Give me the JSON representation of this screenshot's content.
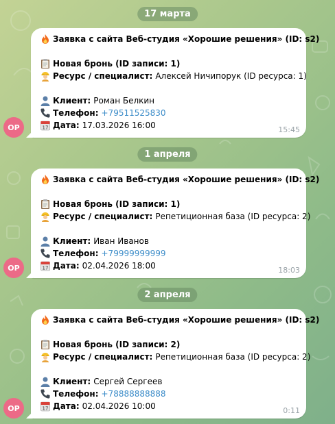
{
  "chat": {
    "messages": [
      {
        "date": "17 марта",
        "title": "Заявка с сайта Веб-студия «Хорошие решения» (ID: s2)",
        "booking_label": "Новая бронь (ID записи: 1)",
        "resource_label": "Ресурс / специалист:",
        "resource_value": "Алексей Ничипорук (ID ресурса: 1)",
        "client_label": "Клиент:",
        "client_value": "Роман Белкин",
        "phone_label": "Телефон:",
        "phone_value": "+79511525830",
        "date_label": "Дата:",
        "date_value": "17.03.2026 16:00",
        "time": "15:45",
        "avatar": "OP"
      },
      {
        "date": "1 апреля",
        "title": "Заявка с сайта Веб-студия «Хорошие решения» (ID: s2)",
        "booking_label": "Новая бронь (ID записи: 1)",
        "resource_label": "Ресурс / специалист:",
        "resource_value": "Репетиционная база (ID ресурса: 2)",
        "client_label": "Клиент:",
        "client_value": "Иван Иванов",
        "phone_label": "Телефон:",
        "phone_value": "+79999999999",
        "date_label": "Дата:",
        "date_value": "02.04.2026 18:00",
        "time": "18:03",
        "avatar": "OP"
      },
      {
        "date": "2 апреля",
        "title": "Заявка с сайта Веб-студия «Хорошие решения» (ID: s2)",
        "booking_label": "Новая бронь (ID записи: 2)",
        "resource_label": "Ресурс / специалист:",
        "resource_value": "Репетиционная база (ID ресурса: 2)",
        "client_label": "Клиент:",
        "client_value": "Сергей Сергеев",
        "phone_label": "Телефон:",
        "phone_value": "+78888888888",
        "date_label": "Дата:",
        "date_value": "02.04.2026 10:00",
        "time": "0:11",
        "avatar": "OP"
      }
    ],
    "icons": [
      "fire-icon",
      "clipboard-icon",
      "worker-icon",
      "person-silhouette-icon",
      "telephone-icon",
      "calendar-icon"
    ],
    "colors": {
      "link": "#3a8bc8",
      "avatar": "#ec6a87",
      "bubble": "#ffffff"
    }
  }
}
